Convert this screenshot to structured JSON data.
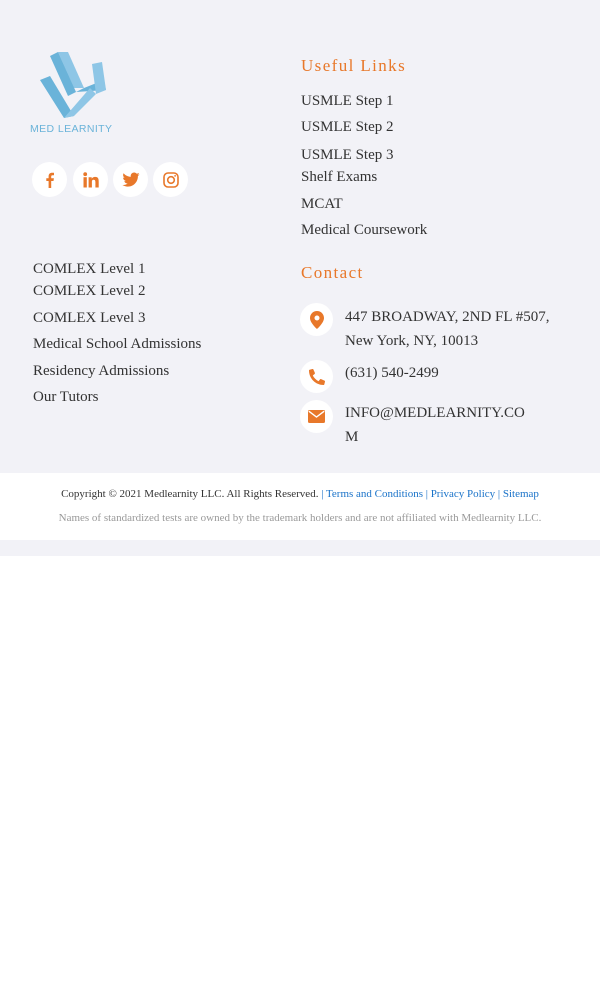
{
  "brand": {
    "logo_text": "MED LEARNITY"
  },
  "social": {
    "icons": [
      "facebook-icon",
      "linkedin-icon",
      "twitter-icon",
      "instagram-icon"
    ]
  },
  "useful_links": {
    "heading": "Useful Links",
    "items": [
      "USMLE Step 1",
      "USMLE Step 2",
      "USMLE Step 3",
      "Shelf Exams",
      "MCAT",
      "Medical Coursework"
    ]
  },
  "left_links": {
    "items": [
      "COMLEX Level 1",
      "COMLEX Level 2",
      "COMLEX Level 3",
      "Medical School Admissions",
      "Residency Admissions",
      "Our Tutors"
    ]
  },
  "contact": {
    "heading": "Contact",
    "address_line1": "447 BROADWAY, 2ND FL #507,",
    "address_line2": "New York, NY, 10013",
    "phone": "(631) 540-2499",
    "email_line1": "INFO@MEDLEARNITY.CO",
    "email_line2": "M"
  },
  "copyright": {
    "text": "Copyright © 2021 Medlearnity LLC. All Rights Reserved.",
    "separator": "|",
    "terms": "Terms and Conditions",
    "privacy": "Privacy Policy",
    "sitemap": "Sitemap",
    "disclaimer": "Names of standardized tests are owned by the trademark holders and are not affiliated with Medlearnity LLC."
  },
  "colors": {
    "accent": "#e8782a",
    "logo_blue": "#6ab3d9",
    "link_blue": "#1a73c9",
    "footer_bg": "#f2f2f7"
  }
}
